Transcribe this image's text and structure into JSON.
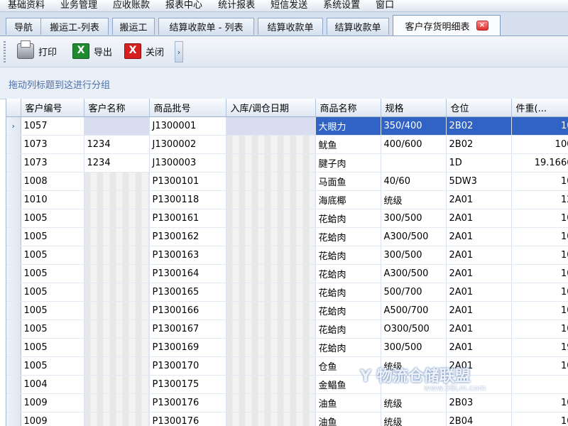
{
  "menubar": {
    "items": [
      "基础资料",
      "业务管理",
      "应收账款",
      "报表中心",
      "统计报表",
      "短信发送",
      "系统设置",
      "窗口"
    ]
  },
  "tabs": [
    {
      "label": "导航"
    },
    {
      "label": "搬运工-列表"
    },
    {
      "label": "搬运工"
    },
    {
      "label": "结算收款单 - 列表"
    },
    {
      "label": "结算收款单"
    },
    {
      "label": "结算收款单"
    },
    {
      "label": "客户存货明细表",
      "active": true
    }
  ],
  "toolbar": {
    "print_label": "打印",
    "export_label": "导出",
    "close_label": "关闭",
    "more_glyph": "›"
  },
  "group_band": {
    "hint": "拖动列标题到这进行分组"
  },
  "table": {
    "columns": [
      "客户编号",
      "客户名称",
      "商品批号",
      "入库/调仓日期",
      "商品名称",
      "规格",
      "仓位",
      "件重(..."
    ],
    "rows": [
      [
        "1057",
        "",
        "J1300001",
        "",
        "大眼力",
        "350/400",
        "2B02",
        "10"
      ],
      [
        "1073",
        "1234",
        "J1300002",
        "",
        "鱿鱼",
        "400/600",
        "2B02",
        "100"
      ],
      [
        "1073",
        "1234",
        "J1300003",
        "",
        "腱子肉",
        "",
        "1D",
        "19.1666"
      ],
      [
        "1008",
        "",
        "P1300101",
        "",
        "马面鱼",
        "40/60",
        "5DW3",
        "10"
      ],
      [
        "1010",
        "",
        "P1300118",
        "",
        "海底椰",
        "统级",
        "2A01",
        "12"
      ],
      [
        "1005",
        "",
        "P1300161",
        "",
        "花蛤肉",
        "300/500",
        "2A01",
        "10"
      ],
      [
        "1005",
        "",
        "P1300162",
        "",
        "花蛤肉",
        "A300/500",
        "2A01",
        "10"
      ],
      [
        "1005",
        "",
        "P1300163",
        "",
        "花蛤肉",
        "300/500",
        "2A01",
        "10"
      ],
      [
        "1005",
        "",
        "P1300164",
        "",
        "花蛤肉",
        "A300/500",
        "2A01",
        "10"
      ],
      [
        "1005",
        "",
        "P1300165",
        "",
        "花蛤肉",
        "500/700",
        "2A01",
        "10"
      ],
      [
        "1005",
        "",
        "P1300166",
        "",
        "花蛤肉",
        "A500/700",
        "2A01",
        "10"
      ],
      [
        "1005",
        "",
        "P1300167",
        "",
        "花蛤肉",
        "O300/500",
        "2A01",
        "10"
      ],
      [
        "1005",
        "",
        "P1300169",
        "",
        "花蛤肉",
        "300/500",
        "2A01",
        "19"
      ],
      [
        "1005",
        "",
        "P1300170",
        "",
        "仓鱼",
        "统级",
        "2A01",
        "10"
      ],
      [
        "1004",
        "",
        "P1300175",
        "",
        "金鲳鱼",
        "",
        "",
        ""
      ],
      [
        "1009",
        "",
        "P1300176",
        "",
        "油鱼",
        "统级",
        "2B03",
        "10"
      ],
      [
        "1009",
        "",
        "P1300176",
        "",
        "油鱼",
        "统级",
        "2B04",
        "10"
      ]
    ],
    "selected_row": 0,
    "row_indicator": "›"
  },
  "watermark": {
    "text": "Y 物流仓储联盟",
    "sub": "www.56Lm.com"
  }
}
